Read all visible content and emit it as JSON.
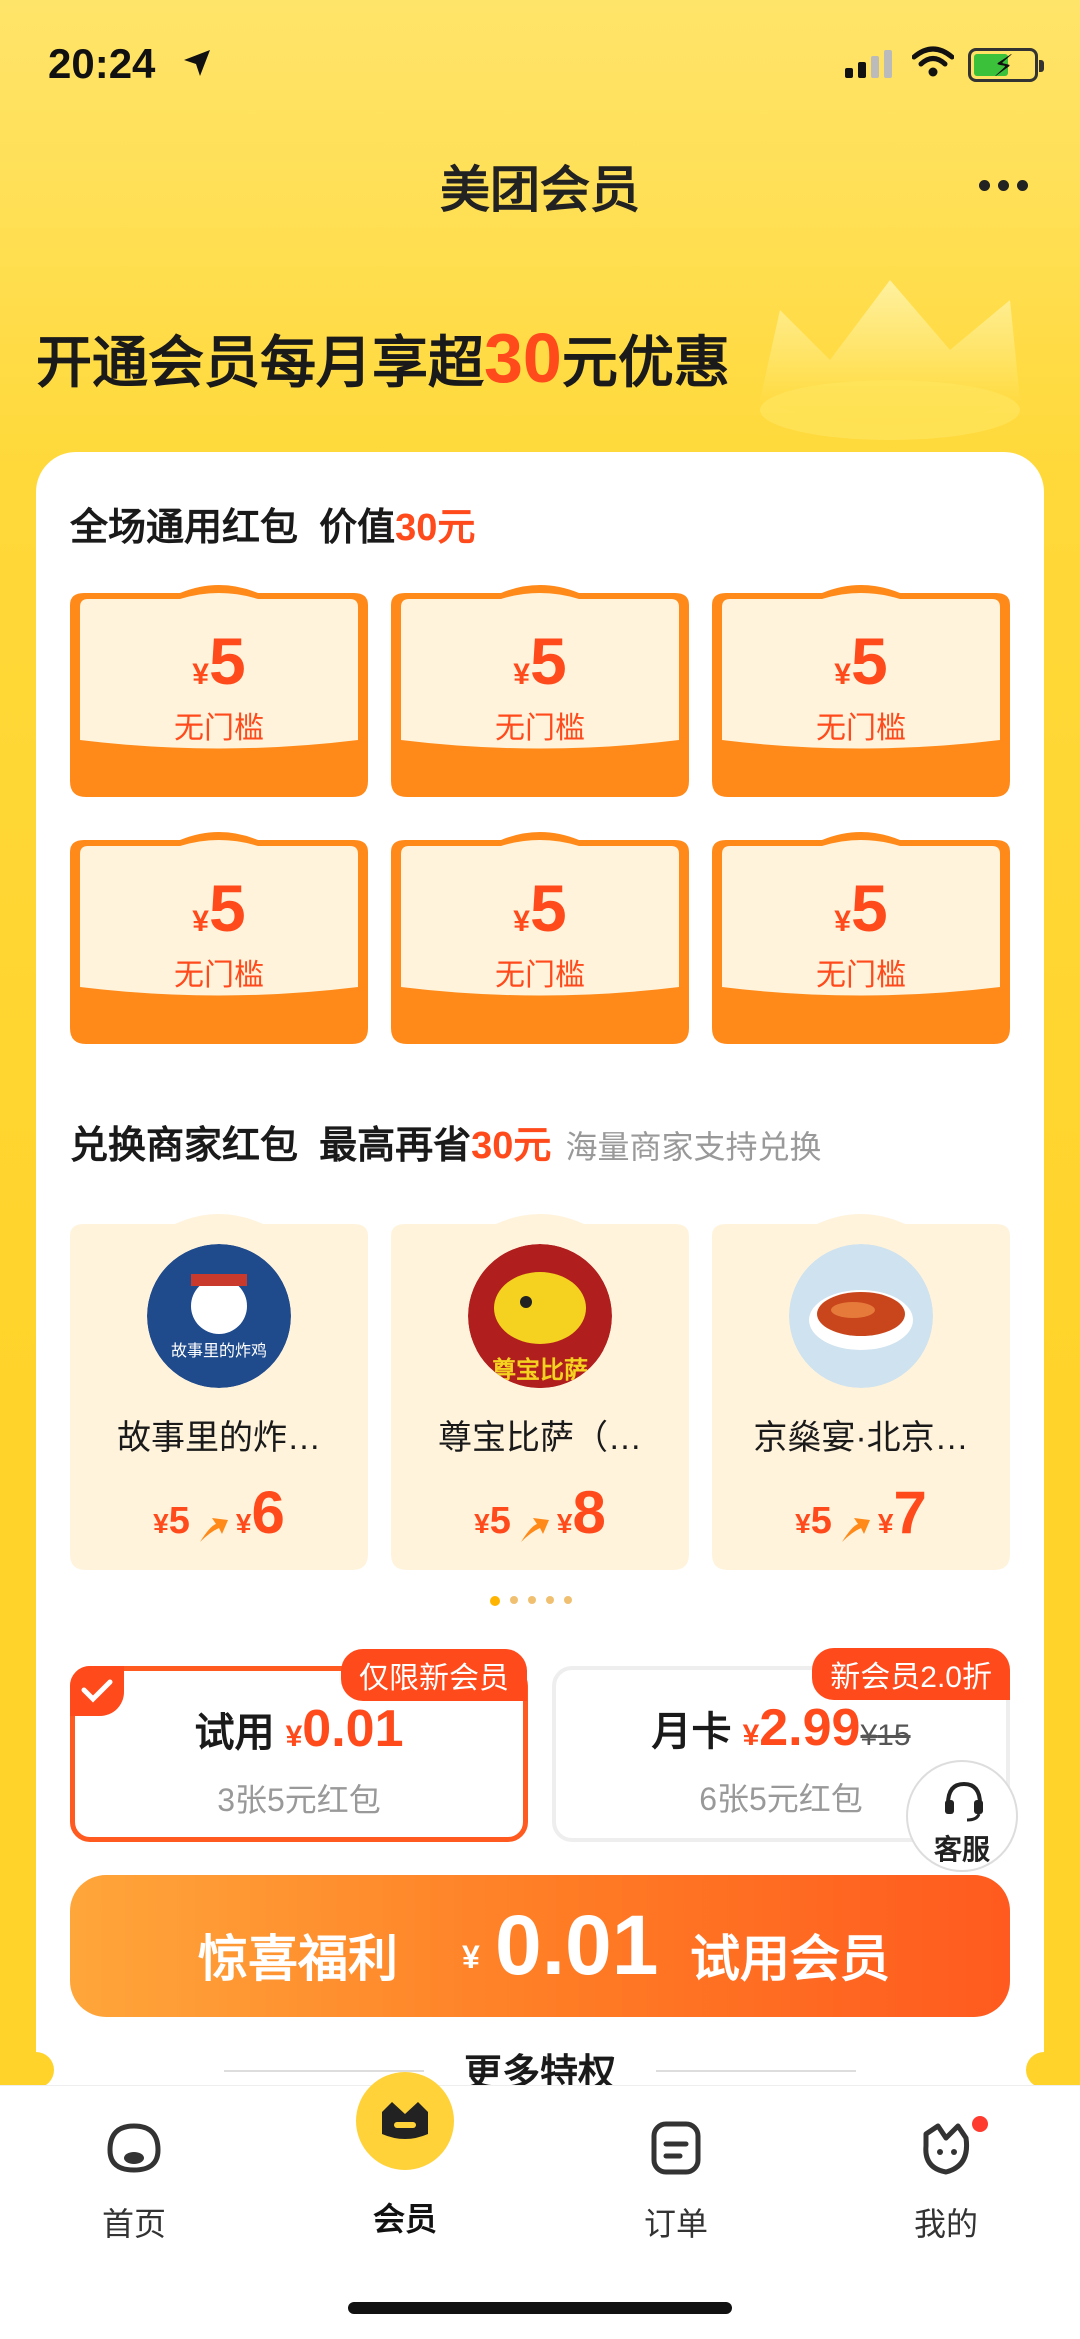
{
  "status_bar": {
    "time": "20:24"
  },
  "header": {
    "title": "美团会员"
  },
  "hero": {
    "prefix": "开通会员每月享超",
    "highlight": "30",
    "suffix": "元优惠"
  },
  "section1": {
    "title": "全场通用红包",
    "value_label": "价值",
    "value": "30元"
  },
  "coupons": [
    {
      "yen": "¥",
      "amount": "5",
      "condition": "无门槛"
    },
    {
      "yen": "¥",
      "amount": "5",
      "condition": "无门槛"
    },
    {
      "yen": "¥",
      "amount": "5",
      "condition": "无门槛"
    },
    {
      "yen": "¥",
      "amount": "5",
      "condition": "无门槛"
    },
    {
      "yen": "¥",
      "amount": "5",
      "condition": "无门槛"
    },
    {
      "yen": "¥",
      "amount": "5",
      "condition": "无门槛"
    }
  ],
  "section2": {
    "title": "兑换商家红包",
    "save_label": "最高再省",
    "save_value": "30元",
    "sub": "海量商家支持兑换"
  },
  "merchants": [
    {
      "name": "故事里的炸…",
      "from_yen": "¥",
      "from": "5",
      "to_yen": "¥",
      "to": "6",
      "logo_text": "故事里的炸鸡"
    },
    {
      "name": "尊宝比萨（…",
      "from_yen": "¥",
      "from": "5",
      "to_yen": "¥",
      "to": "8",
      "logo_text": "尊宝比萨"
    },
    {
      "name": "京燊宴·北京…",
      "from_yen": "¥",
      "from": "5",
      "to_yen": "¥",
      "to": "7",
      "logo_text": ""
    }
  ],
  "plans": [
    {
      "badge": "仅限新会员",
      "name": "试用",
      "yen": "¥",
      "price": "0.01",
      "desc": "3张5元红包",
      "selected": true
    },
    {
      "badge": "新会员2.0折",
      "name": "月卡",
      "yen": "¥",
      "price": "2.99",
      "old_yen": "¥",
      "old_price": "15",
      "desc": "6张5元红包",
      "selected": false
    }
  ],
  "service": {
    "label": "客服"
  },
  "cta": {
    "label": "惊喜福利",
    "yen": "¥",
    "price": "0.01",
    "suffix": "试用会员"
  },
  "more": {
    "title": "更多特权"
  },
  "tabs": [
    {
      "label": "首页",
      "icon": "home-icon"
    },
    {
      "label": "会员",
      "icon": "member-icon"
    },
    {
      "label": "订单",
      "icon": "order-icon"
    },
    {
      "label": "我的",
      "icon": "profile-icon"
    }
  ],
  "colors": {
    "accent": "#ff4a1c",
    "brand_yellow": "#ffd32a"
  }
}
